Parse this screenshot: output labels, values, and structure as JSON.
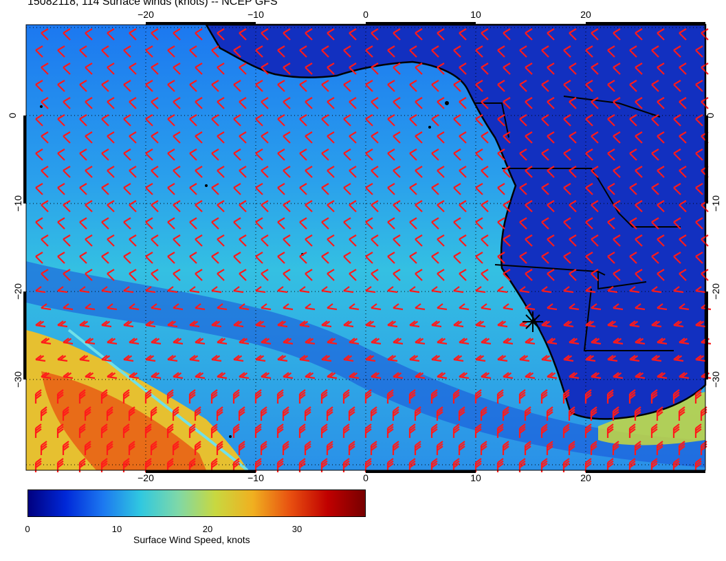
{
  "title": "15082118, 114 Surface winds (knots) -- NCEP GFS",
  "map": {
    "lon_range": [
      -31,
      31
    ],
    "lat_range": [
      -42,
      10
    ],
    "lon_ticks": [
      "−20",
      "−10",
      "0",
      "10",
      "20"
    ],
    "lat_ticks": [
      "0",
      "−10",
      "−20",
      "−30"
    ],
    "grid": "dotted",
    "barb_color": "#ff1a1a",
    "land_color": "#1230c0",
    "coastline_color": "#000000",
    "high_wind_band": "south-west, diagonal along storm front"
  },
  "colorbar": {
    "label": "Surface Wind Speed, knots",
    "min": 0,
    "max": 38,
    "ticks": [
      "0",
      "10",
      "20",
      "30"
    ],
    "colors": [
      "#000080",
      "#0028d8",
      "#1c78f0",
      "#30c8e0",
      "#7ed8a8",
      "#c8d840",
      "#f0b020",
      "#e85010",
      "#c00000",
      "#780000"
    ]
  }
}
